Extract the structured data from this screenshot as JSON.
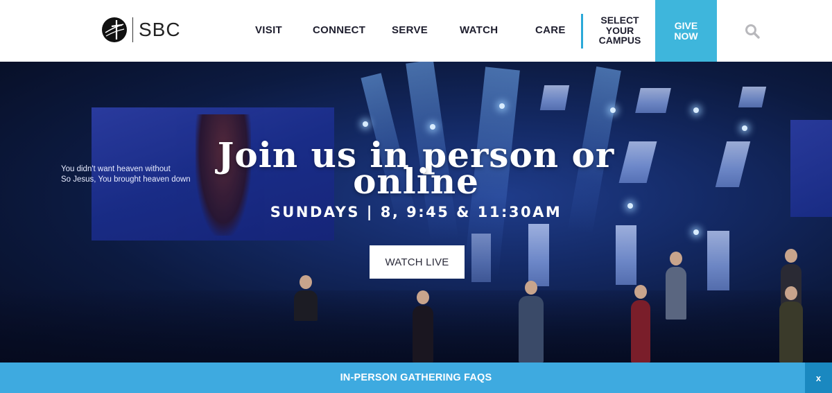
{
  "brand": {
    "name": "SBC",
    "icon": "globe-cross-icon"
  },
  "nav": {
    "items": [
      {
        "label": "VISIT"
      },
      {
        "label": "CONNECT"
      },
      {
        "label": "SERVE"
      },
      {
        "label": "WATCH"
      },
      {
        "label": "CARE"
      }
    ],
    "campus_label": "SELECT YOUR CAMPUS",
    "campus_lines": [
      "SELECT",
      "YOUR",
      "CAMPUS"
    ],
    "give_lines": [
      "GIVE",
      "NOW"
    ],
    "search_icon": "search-icon"
  },
  "hero": {
    "title_line1": "Join us in person or",
    "title_line2": "online",
    "subtitle": "SUNDAYS | 8, 9:45 & 11:30AM",
    "cta_label": "WATCH LIVE",
    "screen_lyrics": [
      "You didn't want heaven without",
      "So Jesus, You brought heaven down"
    ]
  },
  "footer_bar": {
    "link_label": "IN-PERSON GATHERING FAQS",
    "close_label": "x"
  },
  "colors": {
    "accent": "#3eb6dc",
    "bar": "#3eaae0",
    "close_bg": "#1a88c0",
    "nav_text": "#1e1e2e",
    "campus_divider": "#2ba9d8"
  }
}
